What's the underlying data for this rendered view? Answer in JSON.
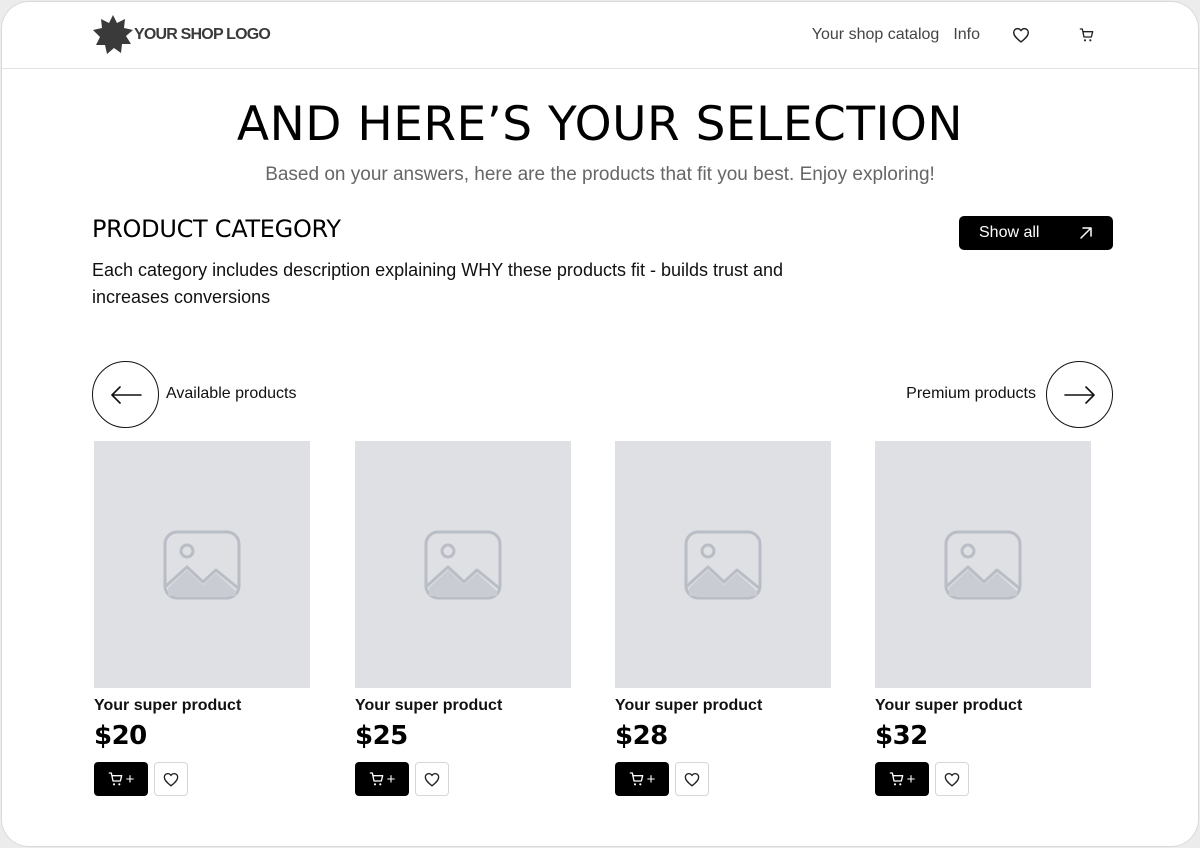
{
  "header": {
    "logo_text": "YOUR SHOP LOGO",
    "nav": {
      "catalog": "Your shop catalog",
      "info": "Info"
    },
    "icons": [
      "heart-icon",
      "cart-icon"
    ]
  },
  "hero": {
    "title": "AND HERE’S YOUR SELECTION",
    "subtitle": "Based on your answers, here are the products that fit you best. Enjoy exploring!"
  },
  "category": {
    "title": "PRODUCT CATEGORY",
    "description": "Each category includes  description explaining WHY these products fit - builds trust and increases conversions",
    "show_all_label": "Show all"
  },
  "carousel": {
    "prev_label": "Available products",
    "next_label": "Premium products"
  },
  "products": [
    {
      "name": "Your super product",
      "price": "$20"
    },
    {
      "name": "Your super product",
      "price": "$25"
    },
    {
      "name": "Your super product",
      "price": "$28"
    },
    {
      "name": "Your super product",
      "price": "$32"
    }
  ],
  "colors": {
    "accent": "#000000",
    "placeholder_bg": "#dfe0e4",
    "placeholder_icon": "#b9bdc6",
    "muted_text": "#666666"
  }
}
